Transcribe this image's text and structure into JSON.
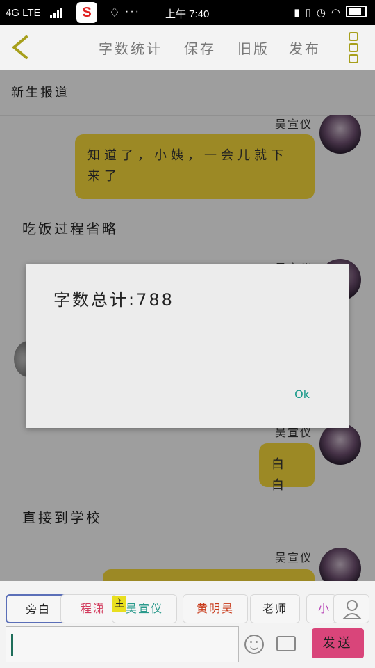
{
  "status_bar": {
    "network": "4G LTE",
    "time": "上午 7:40",
    "app_icon_1": "S",
    "dots": "···"
  },
  "toolbar": {
    "word_count": "字数统计",
    "save": "保存",
    "old_version": "旧版",
    "publish": "发布",
    "accent_color": "#a79f1b"
  },
  "page": {
    "subtitle": "新生报道"
  },
  "chat": [
    {
      "speaker": "吴宣仪",
      "text": "知道了，小姨，一会儿就下来了"
    },
    {
      "narration": "吃饭过程省略"
    },
    {
      "speaker": "吴宣仪",
      "text": "白白"
    },
    {
      "narration": "直接到学校"
    },
    {
      "speaker": "吴宣仪",
      "text": ""
    }
  ],
  "partial_name": "吴宣仪",
  "dialog": {
    "message": "字数总计:788",
    "ok_label": "Ok"
  },
  "roles": {
    "items": [
      {
        "label": "旁白",
        "color": "#333333"
      },
      {
        "label": "程潇",
        "color": "#d23a5c"
      },
      {
        "label": "吴宣仪",
        "color": "#2a9a8c"
      },
      {
        "label": "黄明昊",
        "color": "#c83a1a"
      },
      {
        "label": "老师",
        "color": "#333333"
      },
      {
        "label": "小",
        "color": "#b84ab8"
      }
    ],
    "main_badge": "主"
  },
  "input": {
    "send_label": "发送"
  }
}
